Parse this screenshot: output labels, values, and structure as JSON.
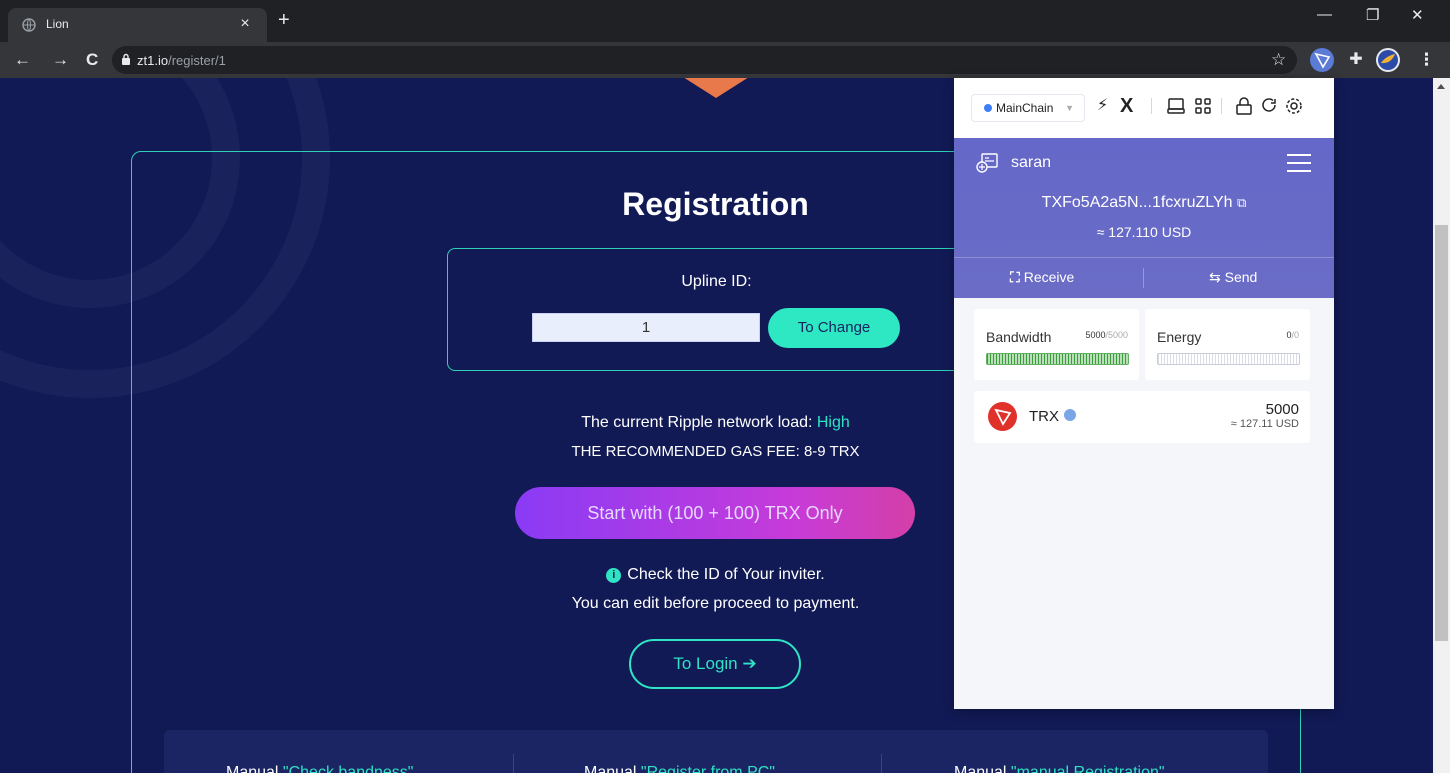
{
  "browser": {
    "tab_title": "Lion",
    "url_host": "zt1.io",
    "url_path": "/register/1"
  },
  "page": {
    "title": "Registration",
    "upline_label": "Upline ID:",
    "upline_value": "1",
    "change_button": "To Change",
    "load_text": "The current Ripple network load: ",
    "load_value": "High",
    "gas_text": "THE RECOMMENDED GAS FEE: 8-9 TRX",
    "start_button": "Start with (100 + 100) TRX Only",
    "check_text": "Check the ID of Your inviter.",
    "edit_text": "You can edit before proceed to payment.",
    "login_button": "To Login",
    "manuals": [
      {
        "prefix": "Manual ",
        "quote": "\"Check bandness\""
      },
      {
        "prefix": "Manual ",
        "quote": "\"Register from PC\""
      },
      {
        "prefix": "Manual ",
        "quote": "\"manual Registration\""
      }
    ],
    "accent_color": "#2fe3c4"
  },
  "wallet": {
    "chain": "MainChain",
    "account_name": "saran",
    "address": "TXFo5A2a5N...1fcxruZLYh",
    "usd_total": "≈ 127.110 USD",
    "receive_label": "Receive",
    "send_label": "Send",
    "bandwidth": {
      "label": "Bandwidth",
      "value": "5000",
      "max": "/5000",
      "level": 1.0
    },
    "energy": {
      "label": "Energy",
      "value": "0",
      "max": "/0",
      "level": 0.0
    },
    "token": {
      "name": "TRX",
      "amount": "5000",
      "usd": "≈ 127.11 USD"
    },
    "header_color": "#6568c8"
  }
}
